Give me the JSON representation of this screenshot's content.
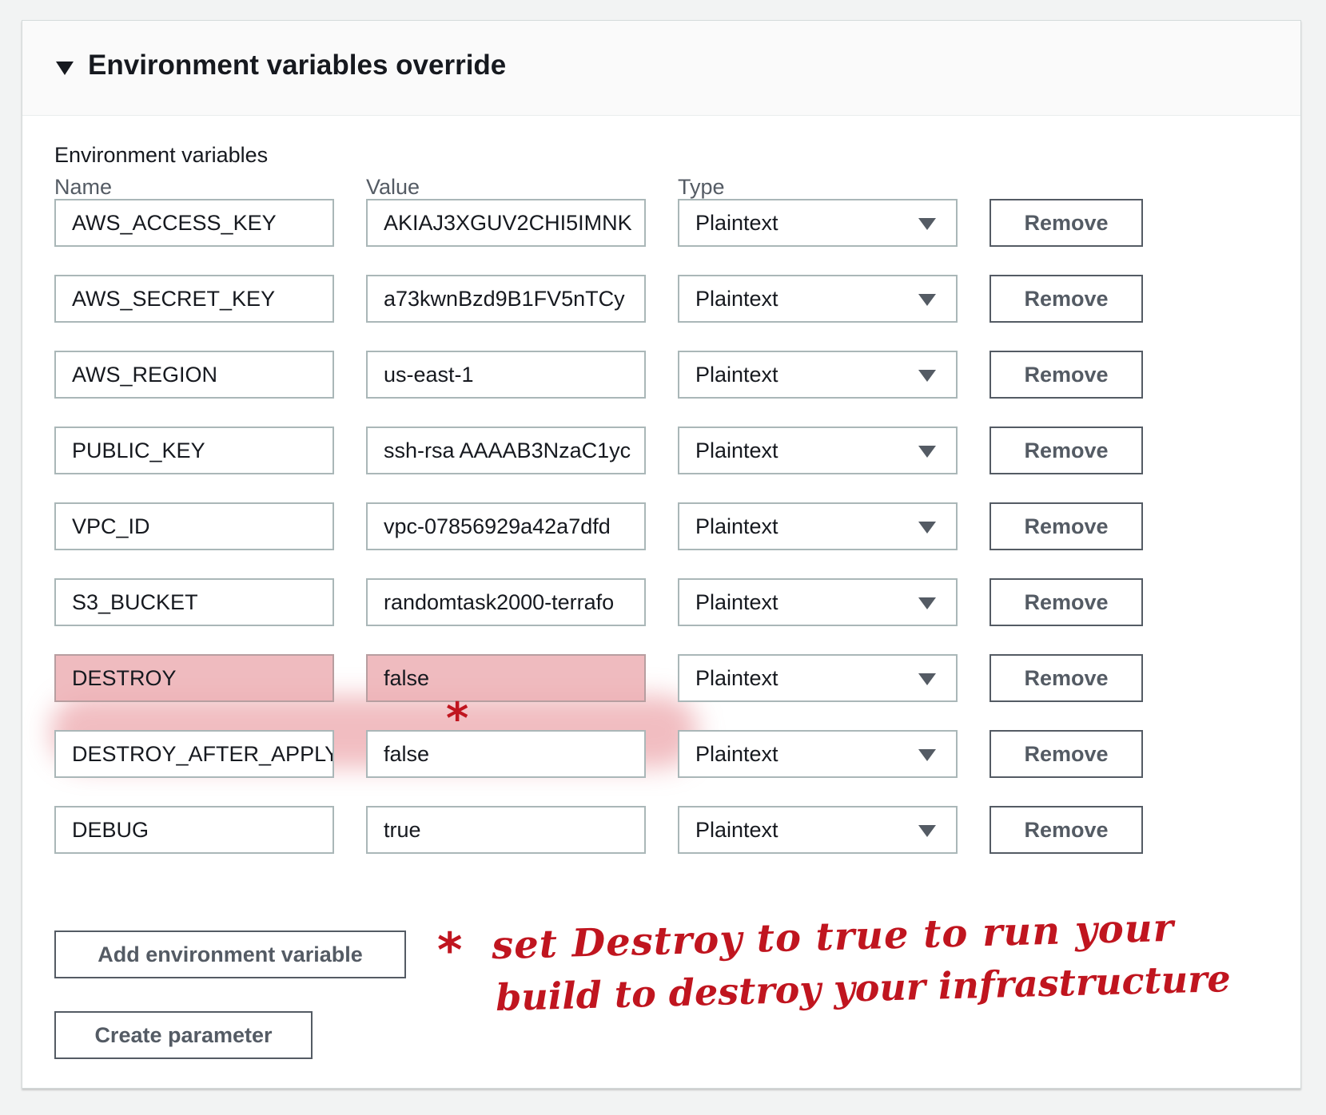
{
  "panel": {
    "title": "Environment variables override"
  },
  "env": {
    "section_label": "Environment variables",
    "columns": {
      "name": "Name",
      "value": "Value",
      "type": "Type"
    },
    "rows": [
      {
        "name": "AWS_ACCESS_KEY",
        "value": "AKIAJ3XGUV2CHI5IMNK",
        "type": "Plaintext",
        "remove": "Remove"
      },
      {
        "name": "AWS_SECRET_KEY",
        "value": "a73kwnBzd9B1FV5nTCy",
        "type": "Plaintext",
        "remove": "Remove"
      },
      {
        "name": "AWS_REGION",
        "value": "us-east-1",
        "type": "Plaintext",
        "remove": "Remove"
      },
      {
        "name": "PUBLIC_KEY",
        "value": "ssh-rsa AAAAB3NzaC1yc",
        "type": "Plaintext",
        "remove": "Remove"
      },
      {
        "name": "VPC_ID",
        "value": "vpc-07856929a42a7dfd",
        "type": "Plaintext",
        "remove": "Remove"
      },
      {
        "name": "S3_BUCKET",
        "value": "randomtask2000-terrafo",
        "type": "Plaintext",
        "remove": "Remove"
      },
      {
        "name": "DESTROY",
        "value": "false",
        "type": "Plaintext",
        "remove": "Remove"
      },
      {
        "name": "DESTROY_AFTER_APPLY",
        "value": "false",
        "type": "Plaintext",
        "remove": "Remove"
      },
      {
        "name": "DEBUG",
        "value": "true",
        "type": "Plaintext",
        "remove": "Remove"
      }
    ],
    "highlighted_row": "DESTROY"
  },
  "actions": {
    "add": "Add environment variable",
    "create": "Create parameter"
  },
  "annotation": {
    "star": "*",
    "line1": "set Destroy to true to run your",
    "line2": "build to destroy your infrastructure",
    "color": "#c0151f"
  },
  "icons": {
    "collapse": "caret-down-icon",
    "dropdown": "dropdown-arrow-icon"
  }
}
